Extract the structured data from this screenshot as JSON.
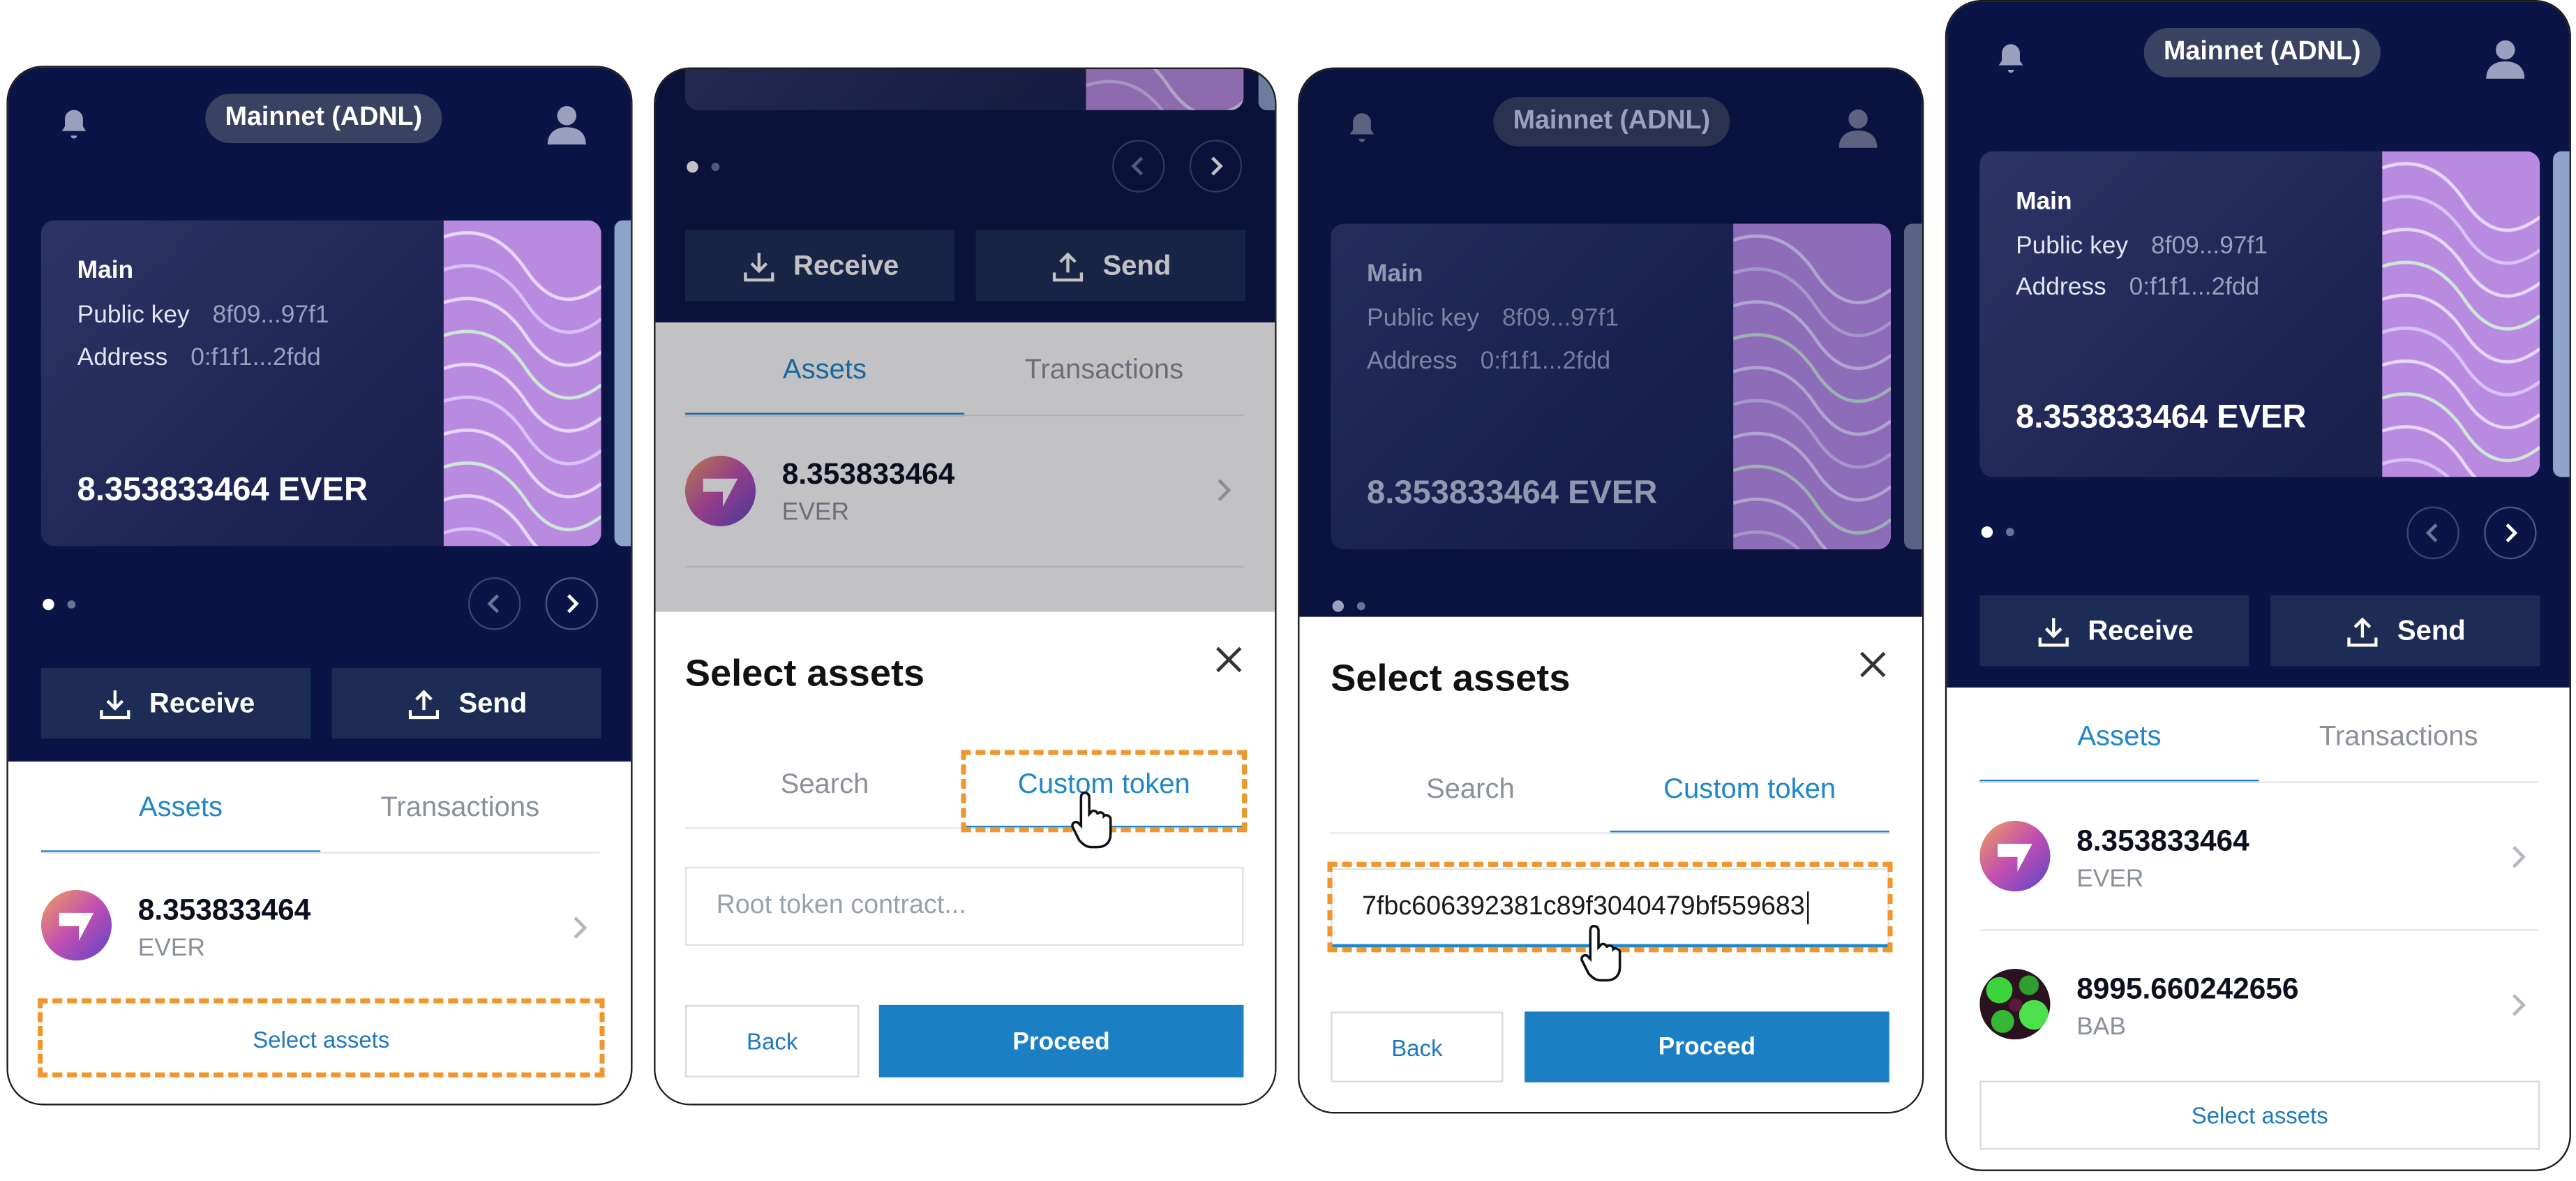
{
  "colors": {
    "navy": "#0b1446",
    "accent": "#1f86c8",
    "primary": "#1b7fc4",
    "highlight": "#f0962d"
  },
  "panel1": {
    "network": "Mainnet (ADNL)",
    "card": {
      "name": "Main",
      "public_key_label": "Public key",
      "public_key": "8f09...97f1",
      "address_label": "Address",
      "address": "0:f1f1...2fdd",
      "balance": "8.353833464 EVER"
    },
    "receive_label": "Receive",
    "send_label": "Send",
    "tabs": [
      "Assets",
      "Transactions"
    ],
    "asset": {
      "amount": "8.353833464",
      "symbol": "EVER"
    },
    "select_assets_label": "Select assets"
  },
  "panel2": {
    "receive_label": "Receive",
    "send_label": "Send",
    "tabs": [
      "Assets",
      "Transactions"
    ],
    "asset": {
      "amount": "8.353833464",
      "symbol": "EVER"
    },
    "sheet": {
      "title": "Select assets",
      "tabs": [
        "Search",
        "Custom token"
      ],
      "placeholder": "Root token contract...",
      "back_label": "Back",
      "proceed_label": "Proceed"
    }
  },
  "panel3": {
    "network": "Mainnet (ADNL)",
    "card": {
      "name": "Main",
      "public_key_label": "Public key",
      "public_key": "8f09...97f1",
      "address_label": "Address",
      "address": "0:f1f1...2fdd",
      "balance": "8.353833464 EVER"
    },
    "sheet": {
      "title": "Select assets",
      "tabs": [
        "Search",
        "Custom token"
      ],
      "value": "7fbc606392381c89f3040479bf559683",
      "back_label": "Back",
      "proceed_label": "Proceed"
    }
  },
  "panel4": {
    "network": "Mainnet (ADNL)",
    "card": {
      "name": "Main",
      "public_key_label": "Public key",
      "public_key": "8f09...97f1",
      "address_label": "Address",
      "address": "0:f1f1...2fdd",
      "balance": "8.353833464 EVER"
    },
    "receive_label": "Receive",
    "send_label": "Send",
    "tabs": [
      "Assets",
      "Transactions"
    ],
    "assets": [
      {
        "amount": "8.353833464",
        "symbol": "EVER"
      },
      {
        "amount": "8995.660242656",
        "symbol": "BAB"
      }
    ],
    "select_assets_label": "Select assets"
  }
}
